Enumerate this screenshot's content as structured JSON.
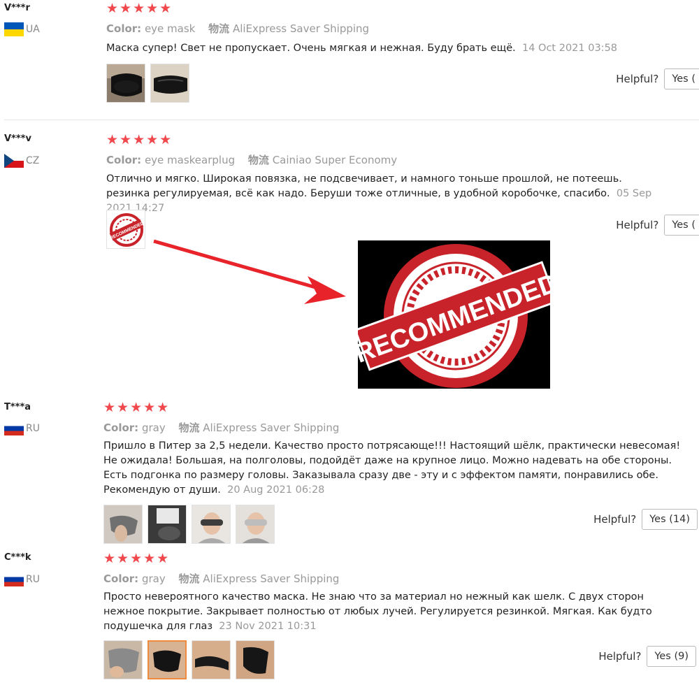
{
  "helpful_label": "Helpful?",
  "meta_labels": {
    "color": "Color:",
    "logistics": "物流"
  },
  "reviews": [
    {
      "user": "V***r",
      "country": "UA",
      "color_value": "eye mask",
      "shipping": "AliExpress Saver Shipping",
      "text": "Маска супер! Свет не пропускает. Очень мягкая и нежная. Буду брать ещё.",
      "date": "14 Oct 2021 03:58",
      "yes_label": "Yes ("
    },
    {
      "user": "V***v",
      "country": "CZ",
      "color_value": "eye maskearplug",
      "shipping": "Cainiao Super Economy",
      "text": "Отлично и мягко. Широкая повязка, не подсвечивает, и намного тоньше прошлой, не потеешь. резинка регулируемая, всё как надо. Беруши тоже отличные, в удобной коробочке, спасибо.",
      "date": "05 Sep 2021 14:27",
      "yes_label": "Yes ("
    },
    {
      "user": "T***a",
      "country": "RU",
      "color_value": "gray",
      "shipping": "AliExpress Saver Shipping",
      "text": "Пришло в Питер за 2,5 недели. Качество просто потрясающе!!! Настоящий шёлк, практически невесомая! Не ожидала! Большая, на полголовы, подойдёт даже на крупное лицо. Можно надевать на обе стороны. Есть подгонка по размеру головы. Заказывала сразу две - эту и с эффектом памяти, понравились обе. Рекомендую от души.",
      "date": "20 Aug 2021 06:28",
      "yes_label": "Yes (14)"
    },
    {
      "user": "C***k",
      "country": "RU",
      "color_value": "gray",
      "shipping": "AliExpress Saver Shipping",
      "text": "Просто невероятного качество маска. Не знаю что за материал но нежный как шелк. С двух сторон нежное покрытие. Закрывает полностью от любых лучей. Регулируется резинкой. Мягкая. Как будто подушечка для глаз",
      "date": "23 Nov 2021 10:31",
      "yes_label": "Yes (9)"
    }
  ],
  "stars": "★★★★★",
  "stamp_text": "RECOMMENDED",
  "colors": {
    "accent_red": "#f0484c",
    "arrow_red": "#e8232a",
    "selected_border": "#f08a3c"
  }
}
